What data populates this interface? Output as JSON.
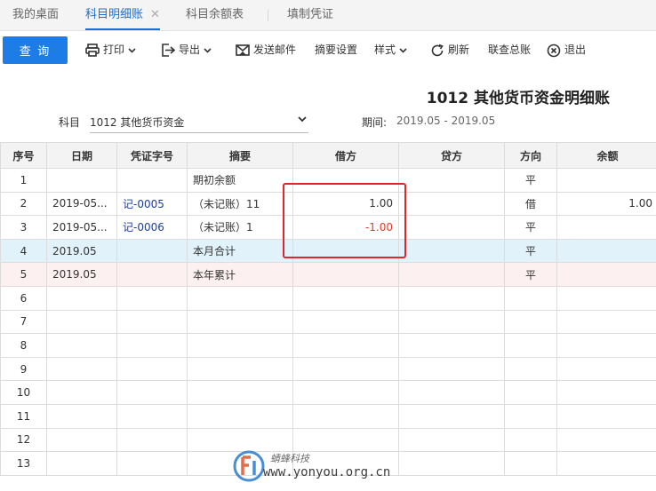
{
  "tabs": [
    {
      "label": "我的桌面",
      "active": false
    },
    {
      "label": "科目明细账",
      "active": true,
      "closable": true
    },
    {
      "label": "科目余额表",
      "active": false
    },
    {
      "label": "填制凭证",
      "active": false
    }
  ],
  "toolbar": {
    "query": "查 询",
    "print": "打印",
    "export": "导出",
    "send_mail": "发送邮件",
    "summary_settings": "摘要设置",
    "style": "样式",
    "refresh": "刷新",
    "query_ledger": "联查总账",
    "exit": "退出"
  },
  "report": {
    "title": "1012 其他货币资金明细账",
    "subject_label": "科目",
    "subject_value": "1012 其他货币资金",
    "period_label": "期间:",
    "period_value": "2019.05 - 2019.05"
  },
  "table": {
    "headers": [
      "序号",
      "日期",
      "凭证字号",
      "摘要",
      "借方",
      "贷方",
      "方向",
      "余额"
    ],
    "rows": [
      {
        "no": "1",
        "date": "",
        "voucher": "",
        "summary": "期初余额",
        "debit": "",
        "credit": "",
        "direction": "平",
        "balance": ""
      },
      {
        "no": "2",
        "date": "2019-05...",
        "voucher": "记-0005",
        "summary": "（未记账）11",
        "debit": "1.00",
        "credit": "",
        "direction": "借",
        "balance": "1.00"
      },
      {
        "no": "3",
        "date": "2019-05...",
        "voucher": "记-0006",
        "summary": "（未记账）1",
        "debit": "-1.00",
        "credit": "",
        "direction": "平",
        "balance": ""
      },
      {
        "no": "4",
        "date": "2019.05",
        "voucher": "",
        "summary": "本月合计",
        "debit": "",
        "credit": "",
        "direction": "平",
        "balance": ""
      },
      {
        "no": "5",
        "date": "2019.05",
        "voucher": "",
        "summary": "本年累计",
        "debit": "",
        "credit": "",
        "direction": "平",
        "balance": ""
      },
      {
        "no": "6",
        "date": "",
        "voucher": "",
        "summary": "",
        "debit": "",
        "credit": "",
        "direction": "",
        "balance": ""
      },
      {
        "no": "7",
        "date": "",
        "voucher": "",
        "summary": "",
        "debit": "",
        "credit": "",
        "direction": "",
        "balance": ""
      },
      {
        "no": "8",
        "date": "",
        "voucher": "",
        "summary": "",
        "debit": "",
        "credit": "",
        "direction": "",
        "balance": ""
      },
      {
        "no": "9",
        "date": "",
        "voucher": "",
        "summary": "",
        "debit": "",
        "credit": "",
        "direction": "",
        "balance": ""
      },
      {
        "no": "10",
        "date": "",
        "voucher": "",
        "summary": "",
        "debit": "",
        "credit": "",
        "direction": "",
        "balance": ""
      },
      {
        "no": "11",
        "date": "",
        "voucher": "",
        "summary": "",
        "debit": "",
        "credit": "",
        "direction": "",
        "balance": ""
      },
      {
        "no": "12",
        "date": "",
        "voucher": "",
        "summary": "",
        "debit": "",
        "credit": "",
        "direction": "",
        "balance": ""
      },
      {
        "no": "13",
        "date": "",
        "voucher": "",
        "summary": "",
        "debit": "",
        "credit": "",
        "direction": "",
        "balance": ""
      }
    ]
  },
  "watermark": {
    "brand": "蜻蜂科技",
    "url": "www.yonyou.org.cn"
  },
  "colors": {
    "primary": "#1e7ce6",
    "highlight": "#e1262a",
    "negative": "#e23a2b",
    "month_row": "#e2f2fb",
    "year_row": "#fdf0f0"
  },
  "icons": [
    "print-icon",
    "export-icon",
    "mail-icon",
    "refresh-icon",
    "exit-icon",
    "chevron-down-icon",
    "close-icon"
  ]
}
